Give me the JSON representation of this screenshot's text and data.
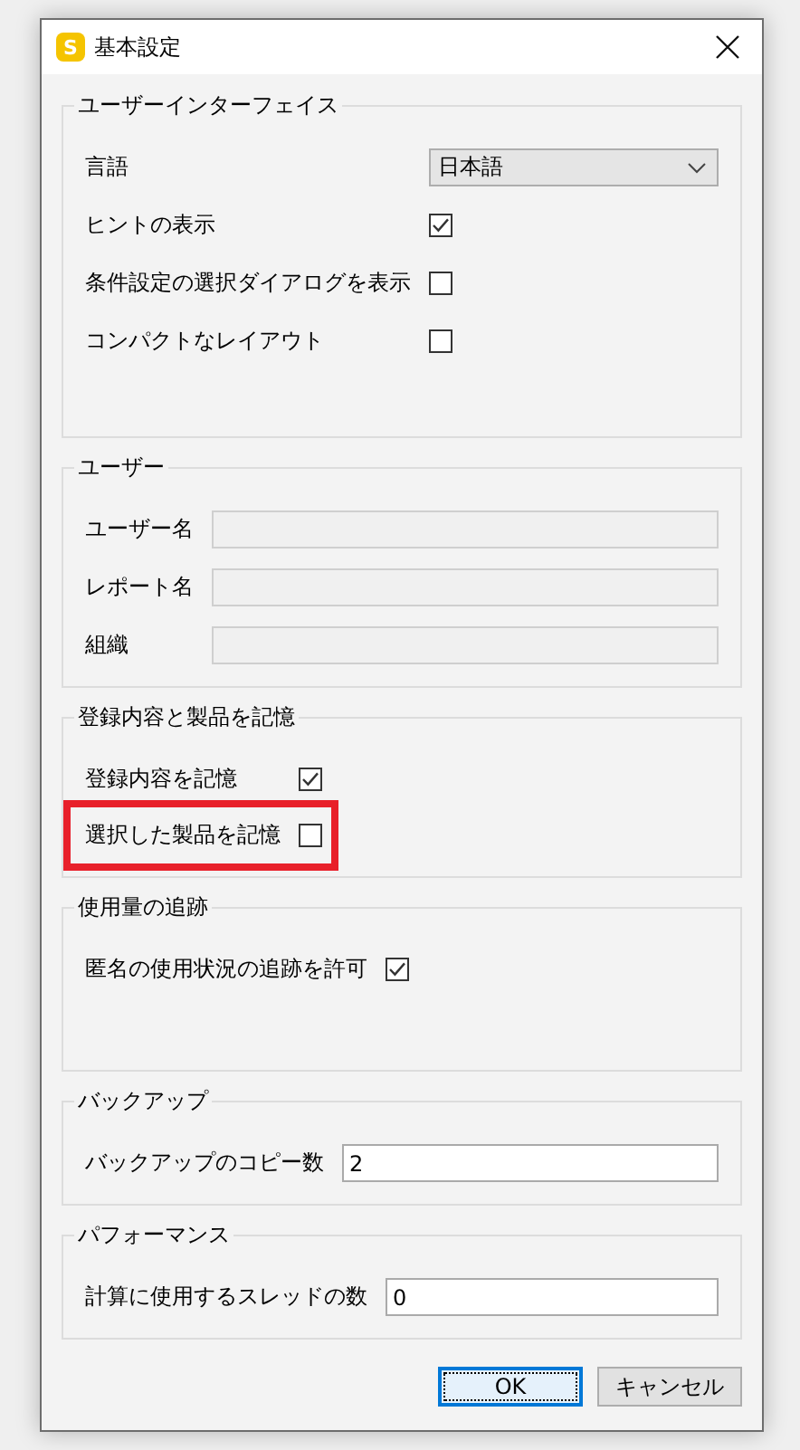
{
  "window": {
    "title": "基本設定",
    "app_icon_letter": "S"
  },
  "groups": [
    {
      "title": "ユーザーインターフェイス",
      "rows": [
        {
          "kind": "dropdown",
          "label": "言語",
          "value": "日本語"
        },
        {
          "kind": "checkbox",
          "label": "ヒントの表示",
          "checked": true
        },
        {
          "kind": "checkbox",
          "label": "条件設定の選択ダイアログを表示",
          "checked": false
        },
        {
          "kind": "checkbox",
          "label": "コンパクトなレイアウト",
          "checked": false
        }
      ]
    },
    {
      "title": "ユーザー",
      "rows": [
        {
          "kind": "text",
          "label": "ユーザー名",
          "disabled": true
        },
        {
          "kind": "text",
          "label": "レポート名",
          "disabled": true
        },
        {
          "kind": "text",
          "label": "組織",
          "disabled": true
        }
      ]
    },
    {
      "title": "登録内容と製品を記憶",
      "rows": [
        {
          "kind": "checkbox",
          "label": "登録内容を記憶",
          "checked": true,
          "highlighted": false
        },
        {
          "kind": "checkbox",
          "label": "選択した製品を記憶",
          "checked": false,
          "highlighted": true
        }
      ]
    },
    {
      "title": "使用量の追跡",
      "rows": [
        {
          "kind": "checkbox",
          "label": "匿名の使用状況の追跡を許可",
          "checked": true
        }
      ]
    },
    {
      "title": "バックアップ",
      "rows": [
        {
          "kind": "text",
          "label": "バックアップのコピー数",
          "value": "2",
          "disabled": false
        }
      ]
    },
    {
      "title": "パフォーマンス",
      "rows": [
        {
          "kind": "text",
          "label": "計算に使用するスレッドの数",
          "value": "0",
          "disabled": false
        }
      ]
    }
  ],
  "buttons": [
    {
      "label": "OK",
      "focused": true
    },
    {
      "label": "キャンセル",
      "focused": false
    }
  ]
}
